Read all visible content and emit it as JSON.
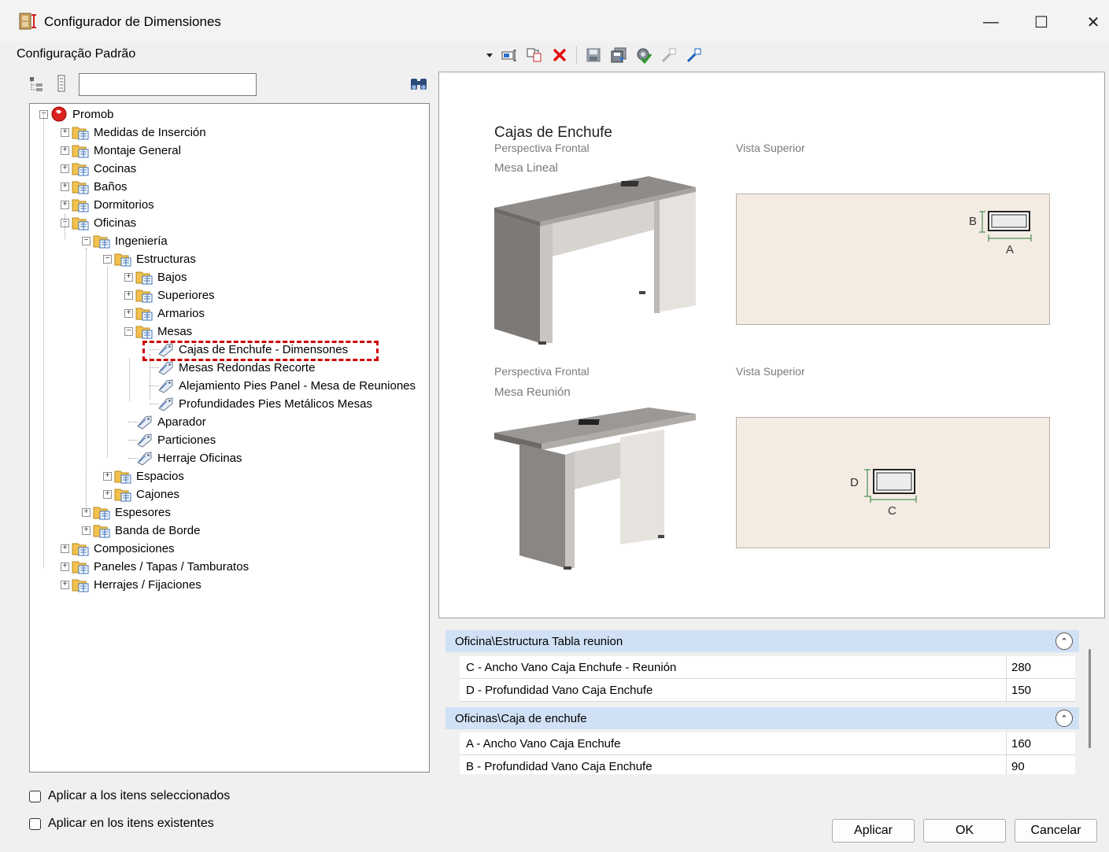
{
  "window": {
    "title": "Configurador de Dimensiones",
    "minimize": "—",
    "maximize": "☐",
    "close": "✕"
  },
  "config_label": "Configuração Padrão",
  "toolbar": {
    "icons": [
      "dropdown-arrow-icon",
      "rename-icon",
      "copy-icon",
      "delete-icon",
      "save-icon",
      "save-all-icon",
      "settings-check-icon",
      "import-icon",
      "export-icon"
    ]
  },
  "search": {
    "value": ""
  },
  "tree": {
    "root": "Promob",
    "level1a": [
      "Medidas de Inserción",
      "Montaje General",
      "Cocinas",
      "Baños",
      "Dormitorios",
      "Oficinas"
    ],
    "oficinas_child": "Ingeniería",
    "ingenieria_child": "Estructuras",
    "estructuras_children": [
      "Bajos",
      "Superiores",
      "Armarios",
      "Mesas"
    ],
    "mesas_children": [
      "Cajas de Enchufe - Dimensones",
      "Mesas Redondas Recorte",
      "Alejamiento Pies Panel - Mesa de Reuniones",
      "Profundidades Pies Metálicos Mesas"
    ],
    "estructuras_items": [
      "Aparador",
      "Particiones",
      "Herraje Oficinas"
    ],
    "ingenieria_more": [
      "Espacios",
      "Cajones"
    ],
    "oficinas_more": [
      "Espesores",
      "Banda de Borde"
    ],
    "level1b": [
      "Composiciones",
      "Paneles / Tapas / Tamburatos",
      "Herrajes / Fijaciones"
    ]
  },
  "preview": {
    "title": "Cajas de Enchufe",
    "persp1": "Perspectiva Frontal",
    "desk1": "Mesa Lineal",
    "top1": "Vista Superior",
    "persp2": "Perspectiva Frontal",
    "desk2": "Mesa Reunión",
    "top2": "Vista Superior",
    "dimA": "A",
    "dimB": "B",
    "dimC": "C",
    "dimD": "D"
  },
  "properties": {
    "groups": [
      {
        "name": "Oficina\\Estructura Tabla reunion",
        "rows": [
          {
            "label": "C - Ancho Vano Caja Enchufe - Reunión",
            "value": "280"
          },
          {
            "label": "D - Profundidad Vano Caja Enchufe",
            "value": "150"
          }
        ]
      },
      {
        "name": "Oficinas\\Caja de enchufe",
        "rows": [
          {
            "label": "A - Ancho Vano Caja Enchufe",
            "value": "160"
          },
          {
            "label": "B - Profundidad Vano Caja Enchufe",
            "value": "90"
          }
        ]
      }
    ]
  },
  "options": {
    "apply_selected": "Aplicar a los itens seleccionados",
    "apply_existing": "Aplicar en los itens existentes"
  },
  "buttons": {
    "apply": "Aplicar",
    "ok": "OK",
    "cancel": "Cancelar"
  },
  "colors": {
    "highlight": "#d00000",
    "group_header": "#d0e1f5",
    "top_view": "#f4ece3"
  }
}
